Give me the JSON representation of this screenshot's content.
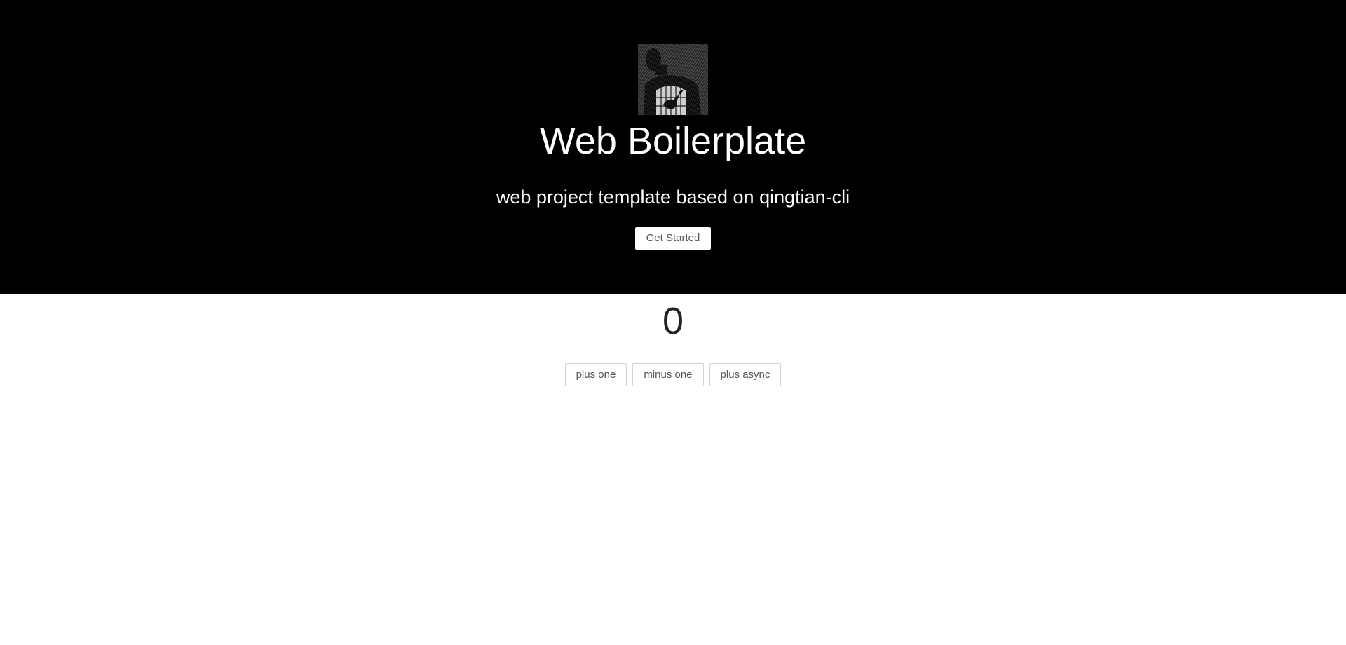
{
  "hero": {
    "logo_icon": "man-with-caged-bird-logo",
    "title": "Web Boilerplate",
    "subtitle": "web project template based on qingtian-cli",
    "cta_label": "Get Started"
  },
  "counter": {
    "value": "0",
    "buttons": [
      {
        "label": "plus one"
      },
      {
        "label": "minus one"
      },
      {
        "label": "plus async"
      }
    ]
  },
  "colors": {
    "hero_bg": "#000000",
    "page_bg": "#ffffff",
    "text_light": "#ffffff",
    "text_dark": "#222222",
    "button_text": "#555555",
    "button_border": "#d0d0d0"
  }
}
